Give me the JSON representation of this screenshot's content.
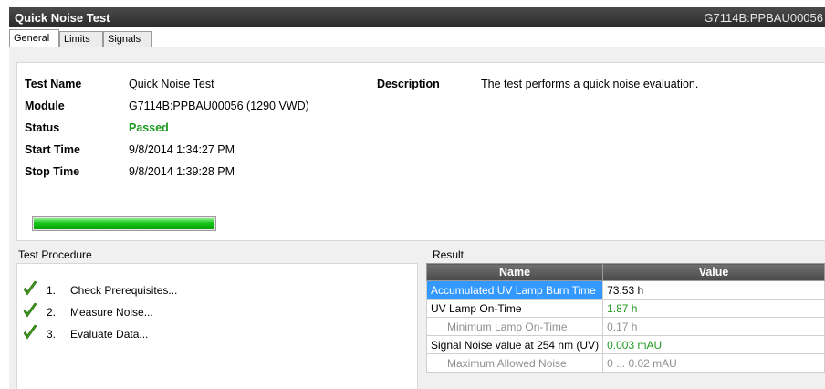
{
  "window": {
    "title": "Quick Noise Test",
    "module_id": "G7114B:PPBAU00056"
  },
  "tabs": [
    {
      "label": "General"
    },
    {
      "label": "Limits"
    },
    {
      "label": "Signals"
    }
  ],
  "info": {
    "test_name_label": "Test Name",
    "test_name": "Quick Noise Test",
    "module_label": "Module",
    "module": "G7114B:PPBAU00056 (1290 VWD)",
    "status_label": "Status",
    "status": "Passed",
    "start_label": "Start Time",
    "start": "9/8/2014 1:34:27 PM",
    "stop_label": "Stop Time",
    "stop": "9/8/2014 1:39:28 PM",
    "description_label": "Description",
    "description": "The test performs a quick noise evaluation.",
    "progress_fraction": 1.0,
    "status_color": "#1e9a1e"
  },
  "procedure": {
    "title": "Test Procedure",
    "steps": [
      {
        "num": "1.",
        "name": "Check Prerequisites...",
        "icon": "check-icon"
      },
      {
        "num": "2.",
        "name": "Measure Noise...",
        "icon": "check-icon"
      },
      {
        "num": "3.",
        "name": "Evaluate Data...",
        "icon": "check-icon"
      }
    ]
  },
  "result": {
    "title": "Result",
    "headers": {
      "name": "Name",
      "value": "Value"
    },
    "rows": [
      {
        "name": "Accumulated UV Lamp Burn Time",
        "value": "73.53 h"
      },
      {
        "name": "UV Lamp On-Time",
        "value": "1.87 h"
      },
      {
        "name": "Minimum Lamp On-Time",
        "value": "0.17 h"
      },
      {
        "name": "Signal Noise value at 254 nm (UV)",
        "value": "0.003 mAU"
      },
      {
        "name": "Maximum Allowed Noise",
        "value": "0 ... 0.02 mAU"
      }
    ]
  }
}
